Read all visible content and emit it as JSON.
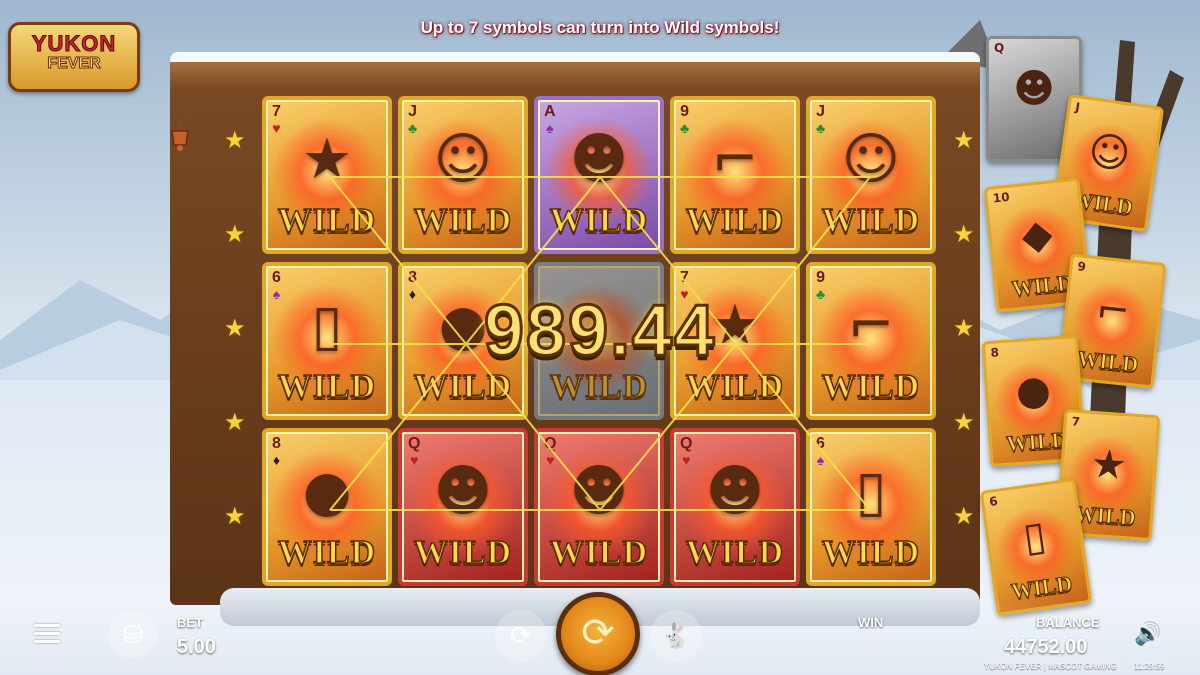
{
  "banner": "Up to 7 symbols can turn into Wild symbols!",
  "logo": {
    "line1": "YUKON",
    "line2": "FEVER"
  },
  "win_amount": "989.44",
  "wild_label": "WILD",
  "grid": [
    [
      {
        "rank": "7",
        "suit": "♥",
        "suit_color": "red",
        "symbol": "sheriff-badge",
        "glyph": "★",
        "style": "gold"
      },
      {
        "rank": "J",
        "suit": "♣",
        "suit_color": "green",
        "symbol": "old-prospector",
        "glyph": "☺",
        "style": "gold"
      },
      {
        "rank": "A",
        "suit": "♠",
        "suit_color": "purple",
        "symbol": "cowboy",
        "glyph": "☻",
        "style": "purple"
      },
      {
        "rank": "9",
        "suit": "♣",
        "suit_color": "green",
        "symbol": "revolver",
        "glyph": "⌐",
        "style": "gold"
      },
      {
        "rank": "J",
        "suit": "♣",
        "suit_color": "green",
        "symbol": "old-prospector",
        "glyph": "☺",
        "style": "gold"
      }
    ],
    [
      {
        "rank": "6",
        "suit": "♠",
        "suit_color": "purple",
        "symbol": "lantern",
        "glyph": "▯",
        "style": "gold"
      },
      {
        "rank": "8",
        "suit": "♦",
        "suit_color": "black",
        "symbol": "gold-sack",
        "glyph": "●",
        "style": "gold"
      },
      {
        "rank": "",
        "suit": "",
        "suit_color": "black",
        "symbol": "faded-wild",
        "glyph": "",
        "style": "dim"
      },
      {
        "rank": "7",
        "suit": "♥",
        "suit_color": "red",
        "symbol": "sheriff-badge",
        "glyph": "★",
        "style": "gold"
      },
      {
        "rank": "9",
        "suit": "♣",
        "suit_color": "green",
        "symbol": "revolver",
        "glyph": "⌐",
        "style": "gold"
      }
    ],
    [
      {
        "rank": "8",
        "suit": "♦",
        "suit_color": "black",
        "symbol": "gold-sack",
        "glyph": "●",
        "style": "gold"
      },
      {
        "rank": "Q",
        "suit": "♥",
        "suit_color": "red",
        "symbol": "cowgirl",
        "glyph": "☻",
        "style": "red"
      },
      {
        "rank": "Q",
        "suit": "♥",
        "suit_color": "red",
        "symbol": "cowgirl",
        "glyph": "☻",
        "style": "red"
      },
      {
        "rank": "Q",
        "suit": "♥",
        "suit_color": "red",
        "symbol": "cowgirl",
        "glyph": "☻",
        "style": "red"
      },
      {
        "rank": "6",
        "suit": "♠",
        "suit_color": "purple",
        "symbol": "lantern",
        "glyph": "▯",
        "style": "gold"
      }
    ]
  ],
  "side_cards": [
    {
      "rank": "Q",
      "symbol": "cowgirl",
      "glyph": "☻",
      "wild": false
    },
    {
      "rank": "J",
      "symbol": "old-prospector",
      "glyph": "☺",
      "wild": true
    },
    {
      "rank": "10",
      "symbol": "gold-nugget",
      "glyph": "◆",
      "wild": true
    },
    {
      "rank": "9",
      "symbol": "revolver",
      "glyph": "⌐",
      "wild": true
    },
    {
      "rank": "8",
      "symbol": "gold-sack",
      "glyph": "●",
      "wild": true
    },
    {
      "rank": "7",
      "symbol": "sheriff-badge",
      "glyph": "★",
      "wild": true
    },
    {
      "rank": "6",
      "symbol": "lantern",
      "glyph": "▯",
      "wild": true
    }
  ],
  "controls": {
    "bet_label": "BET",
    "bet_value": "5.00",
    "win_label": "WIN",
    "balance_label": "BALANCE",
    "balance_value": "44752.00",
    "footer_text": "YUKON FEVER | MASCOT GAMING",
    "clock": "11:29:59"
  },
  "colors": {
    "accent_gold": "#e2a724",
    "payline": "#f4e04a",
    "spin_button": "#e2871a"
  }
}
